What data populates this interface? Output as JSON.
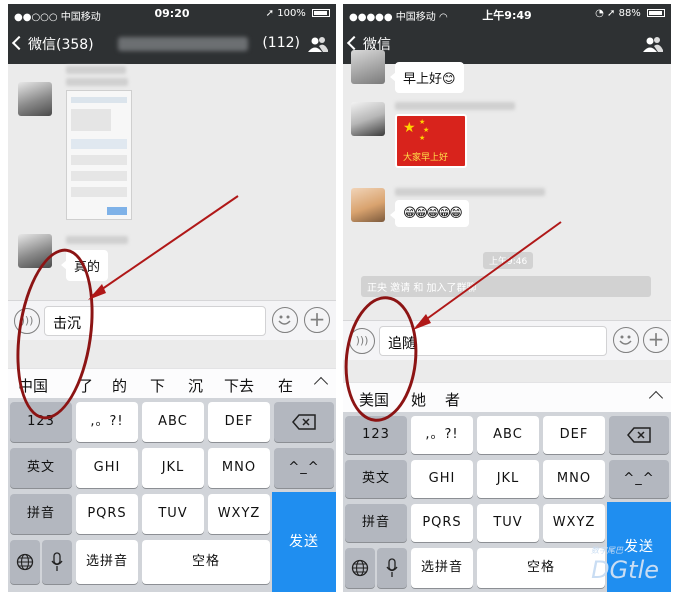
{
  "left": {
    "status": {
      "carrier": "●●○○○ 中国移动",
      "time": "09:20",
      "battery": "100%"
    },
    "nav": {
      "back_label": "微信(358)",
      "count": "(112)"
    },
    "messages": [
      {
        "text": ""
      },
      {
        "text": "真的"
      }
    ],
    "input_value": "击沉",
    "candidates": [
      "中国",
      "了",
      "的",
      "下",
      "沉",
      "下去",
      "在"
    ],
    "keys": {
      "k123": "123",
      "punct": ",。?!",
      "abc": "ABC",
      "def": "DEF",
      "en": "英文",
      "ghi": "GHI",
      "jkl": "JKL",
      "mno": "MNO",
      "emoticon": "^_^",
      "pinyin": "拼音",
      "pqrs": "PQRS",
      "tuv": "TUV",
      "wxyz": "WXYZ",
      "select_pinyin": "选拼音",
      "space": "空格",
      "send": "发送"
    }
  },
  "right": {
    "status": {
      "carrier": "●●●●● 中国移动",
      "time": "上午9:49",
      "battery": "88%"
    },
    "nav": {
      "back_label": "微信"
    },
    "messages": [
      {
        "text": "早上好😊"
      },
      {
        "image_caption": "大家早上好"
      },
      {
        "text": "😁😁😁😁😁"
      }
    ],
    "time_badge": "上午9:46",
    "system_message": "正央         邀请         和        加入了群聊",
    "input_value": "追随",
    "candidates": [
      "美国",
      "她",
      "者"
    ],
    "keys": {
      "k123": "123",
      "punct": ",。?!",
      "abc": "ABC",
      "def": "DEF",
      "en": "英文",
      "ghi": "GHI",
      "jkl": "JKL",
      "mno": "MNO",
      "emoticon": "^_^",
      "pinyin": "拼音",
      "pqrs": "PQRS",
      "tuv": "TUV",
      "wxyz": "WXYZ",
      "select_pinyin": "选拼音",
      "space": "空格",
      "send": "发送"
    }
  },
  "watermark": "DGtle",
  "watermark_sub": "数字尾巴",
  "colors": {
    "navbar": "#2e3133",
    "send": "#1f8ef0",
    "annotation": "#8c1414",
    "chat_bg": "#ebebeb",
    "keyboard_bg": "#d1d4d9"
  },
  "icons": [
    "back-chevron-icon",
    "group-people-icon",
    "voice-icon",
    "emoji-icon",
    "plus-icon",
    "backspace-icon",
    "globe-icon",
    "microphone-icon",
    "collapse-arrow-icon",
    "wifi-icon",
    "location-arrow-icon",
    "alarm-icon"
  ]
}
